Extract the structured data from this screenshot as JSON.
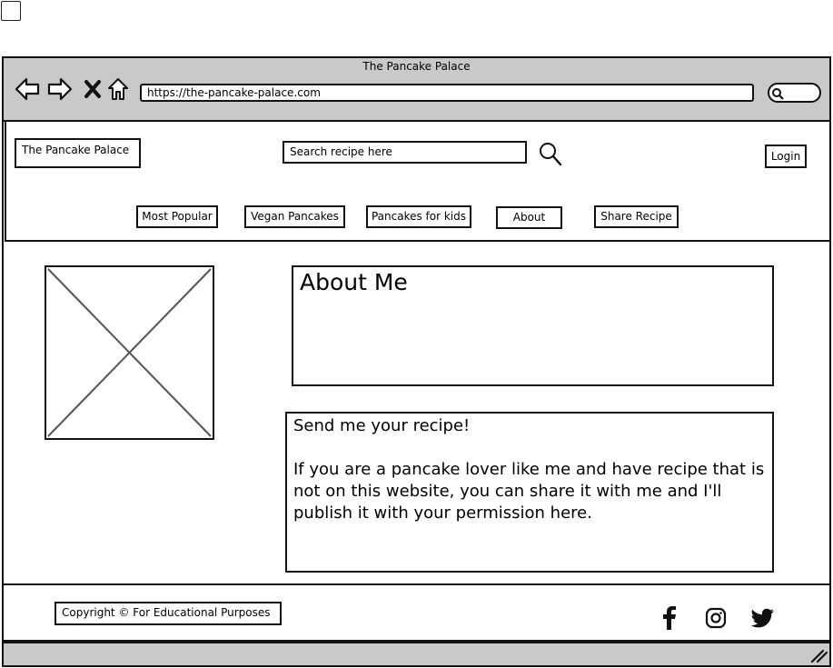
{
  "browser": {
    "title": "The Pancake Palace",
    "url": "https://the-pancake-palace.com",
    "icons": [
      "back-arrow-icon",
      "forward-arrow-icon",
      "close-x-icon",
      "home-icon",
      "search-icon"
    ]
  },
  "header": {
    "logo": "The Pancake Palace",
    "search_placeholder": "Search recipe here",
    "login_label": "Login"
  },
  "nav": {
    "items": [
      {
        "label": "Most Popular"
      },
      {
        "label": "Vegan Pancakes"
      },
      {
        "label": "Pancakes for kids"
      },
      {
        "label": "About"
      },
      {
        "label": "Share Recipe"
      }
    ]
  },
  "main": {
    "about_title": "About Me",
    "recipe_heading": "Send me your recipe!",
    "recipe_body": "If you are a pancake lover like me and have recipe that is not on this website, you can share it with me and I'll publish it with your permission here."
  },
  "footer": {
    "copyright": "Copyright © For Educational Purposes",
    "social_icons": [
      "facebook-icon",
      "instagram-icon",
      "twitter-icon"
    ]
  },
  "colors": {
    "chrome_gray": "#c9c9c9",
    "stroke": "#111111",
    "placeholder_line": "#555555"
  }
}
